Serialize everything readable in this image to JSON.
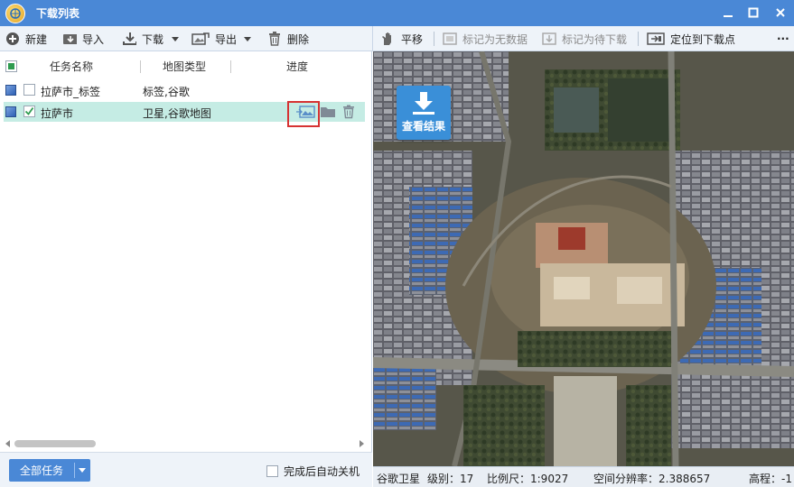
{
  "window": {
    "title": "下载列表",
    "minimize_icon": "minimize-icon",
    "maximize_icon": "maximize-icon",
    "close_icon": "close-icon"
  },
  "toolbar": {
    "new_label": "新建",
    "import_label": "导入",
    "download_label": "下载",
    "export_label": "导出",
    "delete_label": "删除",
    "pan_label": "平移",
    "mark_nodata_label": "标记为无数据",
    "mark_pending_label": "标记为待下载",
    "locate_label": "定位到下载点",
    "more_label": "···"
  },
  "table": {
    "headers": {
      "name": "任务名称",
      "map_type": "地图类型",
      "progress": "进度"
    },
    "rows": [
      {
        "name": "拉萨市_标签",
        "map_type": "标签,谷歌",
        "checked": false,
        "selected": false
      },
      {
        "name": "拉萨市",
        "map_type": "卫星,谷歌地图",
        "checked": true,
        "selected": true
      }
    ]
  },
  "bottom": {
    "all_tasks_label": "全部任务",
    "auto_shutdown_label": "完成后自动关机"
  },
  "map": {
    "view_result_label": "查看结果"
  },
  "status": {
    "map_source": "谷歌卫星",
    "level": "级别：17",
    "scale": "比例尺：1:9027",
    "resolution": "空间分辨率：2.388657",
    "elevation": "高程：-1"
  },
  "colors": {
    "accent": "#4a88d6",
    "selected_row": "#c5ece4",
    "highlight": "#d63333"
  }
}
